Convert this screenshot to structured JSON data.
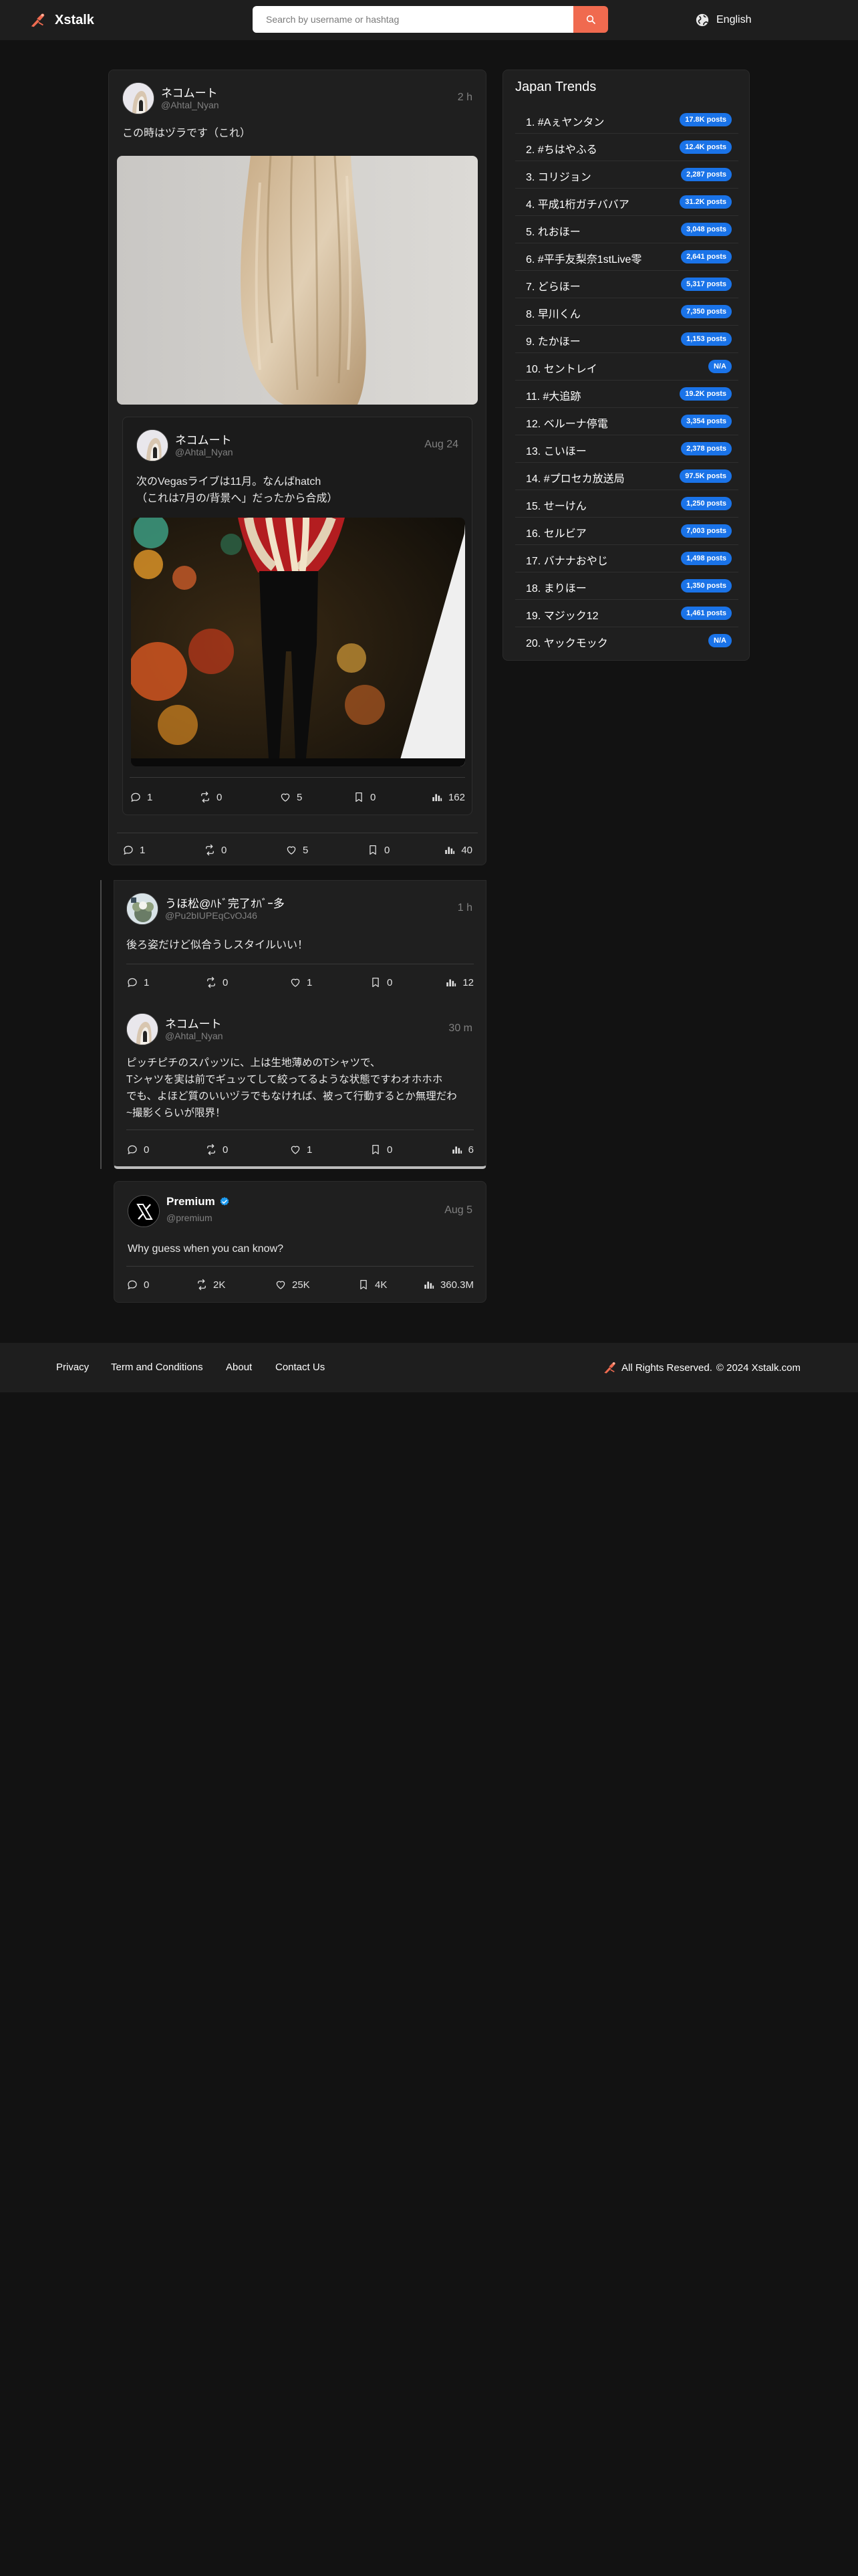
{
  "header": {
    "brand": "Xstalk",
    "search_placeholder": "Search by username or hashtag",
    "language": "English"
  },
  "main_post": {
    "author": "ネコムート",
    "handle": "@Ahtal_Nyan",
    "time": "2 h",
    "text": "この時はヅラです（これ）",
    "image_icon": "hair-photo",
    "stats": {
      "replies": "1",
      "retweets": "0",
      "likes": "5",
      "bookmarks": "0",
      "views": "40"
    },
    "quote": {
      "author": "ネコムート",
      "handle": "@Ahtal_Nyan",
      "time": "Aug 24",
      "text": "次のVegasライブは11月。なんばhatch\n（これは7月の/背景へ」だったから合成）",
      "image_icon": "stage-photo",
      "stats": {
        "replies": "1",
        "retweets": "0",
        "likes": "5",
        "bookmarks": "0",
        "views": "162"
      }
    }
  },
  "thread": {
    "reply1": {
      "author": "うほ松@ﾊﾄﾞ完了ｵﾊﾞｰ多",
      "handle": "@Pu2bIUPEqCvOJ46",
      "time": "1 h",
      "text": "後ろ姿だけど似合うしスタイルいい！",
      "stats": {
        "replies": "1",
        "retweets": "0",
        "likes": "1",
        "bookmarks": "0",
        "views": "12"
      }
    },
    "reply2": {
      "author": "ネコムート",
      "handle": "@Ahtal_Nyan",
      "time": "30 m",
      "text": "ピッチピチのスパッツに、上は生地薄めのTシャツで、\nTシャツを実は前でギュッてして絞ってるような状態ですわオホホホ\nでも、よほど質のいいヅラでもなければ、被って行動するとか無理だわ\n~撮影くらいが限界！",
      "stats": {
        "replies": "0",
        "retweets": "0",
        "likes": "1",
        "bookmarks": "0",
        "views": "6"
      }
    }
  },
  "premium": {
    "author": "Premium",
    "handle": "@premium",
    "time": "Aug 5",
    "text": "Why guess when you can know?",
    "stats": {
      "replies": "0",
      "retweets": "2K",
      "likes": "25K",
      "bookmarks": "4K",
      "views": "360.3M"
    }
  },
  "trends": {
    "title": "Japan Trends",
    "items": [
      {
        "label": "1. #Aぇヤンタン",
        "posts": "17.8K posts"
      },
      {
        "label": "2. #ちはやふる",
        "posts": "12.4K posts"
      },
      {
        "label": "3. コリジョン",
        "posts": "2,287 posts"
      },
      {
        "label": "4. 平成1桁ガチババア",
        "posts": "31.2K posts"
      },
      {
        "label": "5. れおほー",
        "posts": "3,048 posts"
      },
      {
        "label": "6. #平手友梨奈1stLive零",
        "posts": "2,641 posts"
      },
      {
        "label": "7. どらほー",
        "posts": "5,317 posts"
      },
      {
        "label": "8. 早川くん",
        "posts": "7,350 posts"
      },
      {
        "label": "9. たかほー",
        "posts": "1,153 posts"
      },
      {
        "label": "10. セントレイ",
        "posts": "N/A"
      },
      {
        "label": "11. #大追跡",
        "posts": "19.2K posts"
      },
      {
        "label": "12. ベルーナ停電",
        "posts": "3,354 posts"
      },
      {
        "label": "13. こいほー",
        "posts": "2,378 posts"
      },
      {
        "label": "14. #プロセカ放送局",
        "posts": "97.5K posts"
      },
      {
        "label": "15. せーけん",
        "posts": "1,250 posts"
      },
      {
        "label": "16. セルビア",
        "posts": "7,003 posts"
      },
      {
        "label": "17. バナナおやじ",
        "posts": "1,498 posts"
      },
      {
        "label": "18. まりほー",
        "posts": "1,350 posts"
      },
      {
        "label": "19. マジック12",
        "posts": "1,461 posts"
      },
      {
        "label": "20. ヤックモック",
        "posts": "N/A"
      }
    ]
  },
  "footer": {
    "privacy": "Privacy",
    "terms": "Term and Conditions",
    "about": "About",
    "contact": "Contact Us",
    "rights": "All Rights Reserved.",
    "copyright": "© 2024 Xstalk.com"
  },
  "colors": {
    "accent": "#f06a4f",
    "badge": "#1a73e8",
    "verified": "#1d9bf0",
    "background": "#121212",
    "card": "#1f1f1f"
  }
}
